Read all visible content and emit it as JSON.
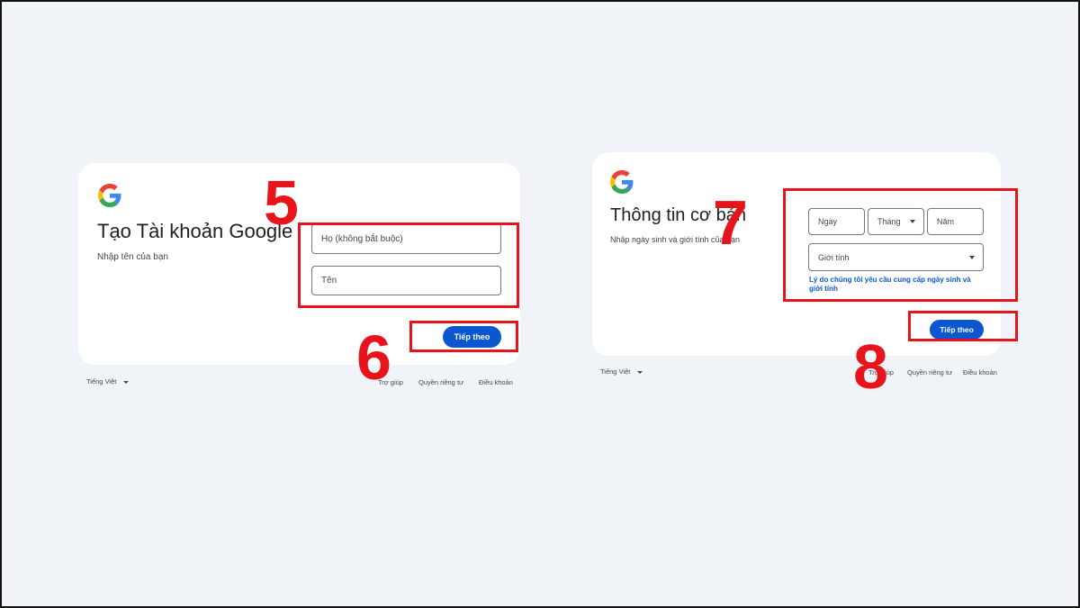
{
  "card1": {
    "title": "Tạo Tài khoản Google",
    "subtitle": "Nhập tên của bạn",
    "last_name_placeholder": "Họ (không bắt buộc)",
    "first_name_placeholder": "Tên",
    "next_label": "Tiếp theo"
  },
  "card2": {
    "title": "Thông tin cơ bản",
    "subtitle": "Nhập ngày sinh và giới tính của bạn",
    "day_placeholder": "Ngày",
    "month_placeholder": "Tháng",
    "year_placeholder": "Năm",
    "gender_placeholder": "Giới tính",
    "why_link": "Lý do chúng tôi yêu cầu cung cấp ngày sinh và giới tính",
    "next_label": "Tiếp theo"
  },
  "footer1": {
    "language": "Tiếng Việt",
    "help": "Trợ giúp",
    "privacy": "Quyền riêng tư",
    "terms": "Điều khoản"
  },
  "footer2": {
    "language": "Tiếng Việt",
    "help": "Trợ giúp",
    "privacy": "Quyền riêng tư",
    "terms": "Điều khoản"
  },
  "steps": {
    "s5": "5",
    "s6": "6",
    "s7": "7",
    "s8": "8"
  },
  "colors": {
    "accent": "#0b57d0",
    "annotation": "#e8141b",
    "background": "#f0f4f9"
  }
}
